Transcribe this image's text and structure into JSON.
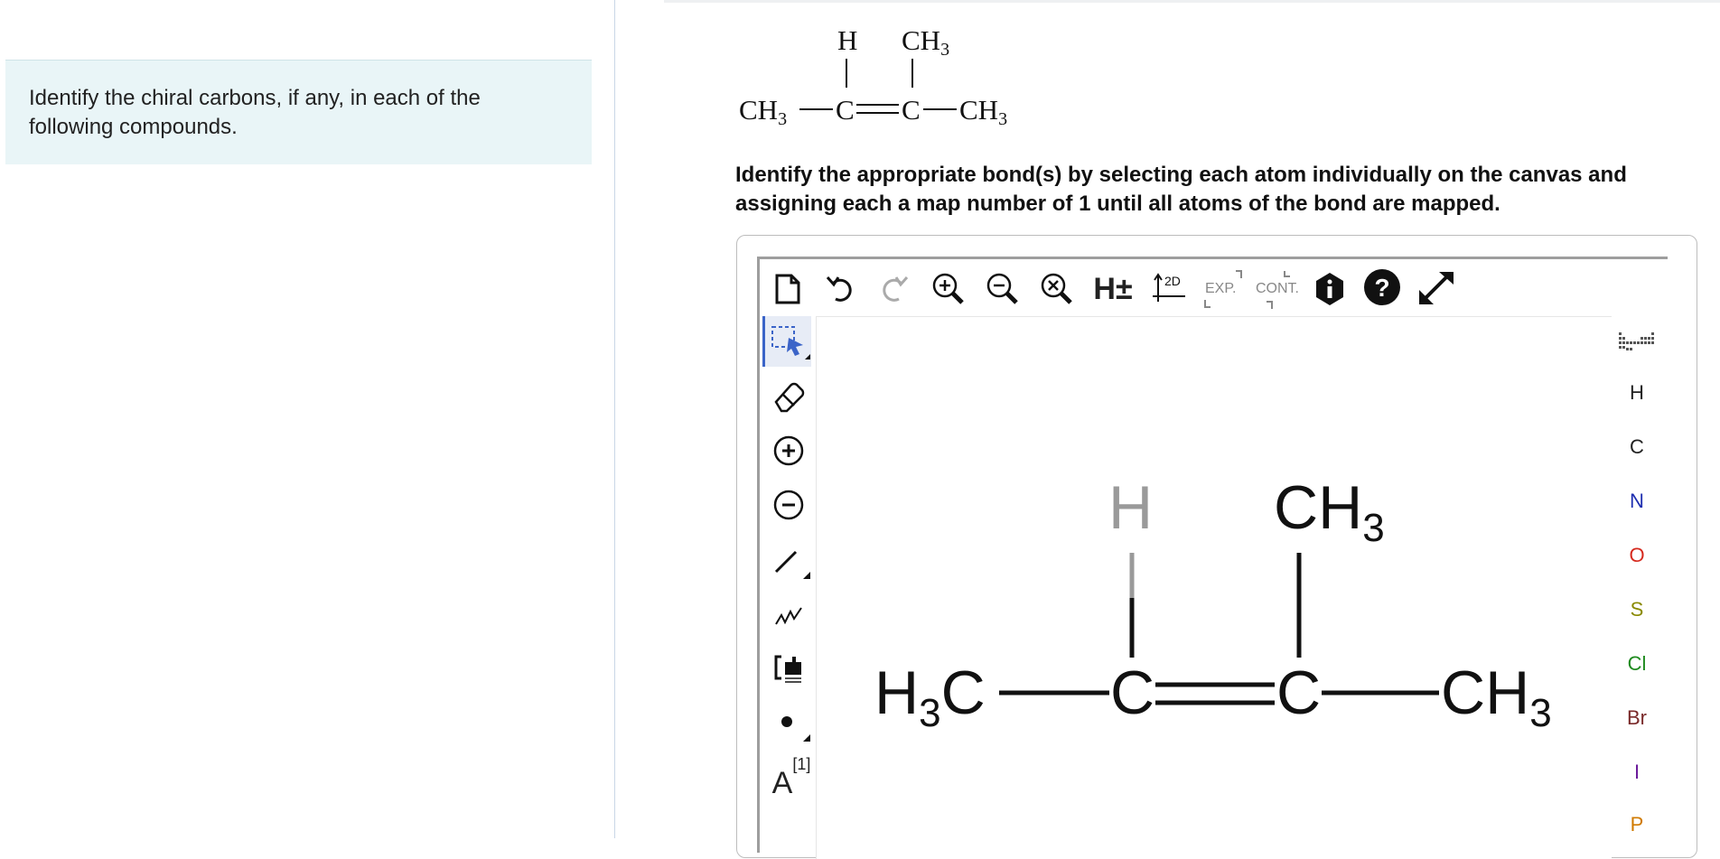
{
  "question": {
    "text": "Identify the chiral carbons, if any, in each of the following compounds."
  },
  "structure_image": {
    "top_h": "H",
    "top_ch": "CH",
    "top_sub": "3",
    "left_ch": "CH",
    "left_sub": "3",
    "c1": "C",
    "c2": "C",
    "right_ch": "CH",
    "right_sub": "3"
  },
  "instruction": "Identify the appropriate bond(s) by selecting each atom individually on the canvas and assigning each a map number of 1 until all atoms of the bond are mapped.",
  "toolbar": {
    "exp_label": "EXP.",
    "cont_label": "CONT.",
    "h_label": "H±",
    "twod_label": "2D"
  },
  "left_tools": {
    "atom_map_label": "A",
    "atom_map_sup": "[1]"
  },
  "elements": [
    {
      "symbol": "H",
      "color": "#333333"
    },
    {
      "symbol": "C",
      "color": "#111111"
    },
    {
      "symbol": "N",
      "color": "#1f2fb0"
    },
    {
      "symbol": "O",
      "color": "#d62a1e"
    },
    {
      "symbol": "S",
      "color": "#8a8a00"
    },
    {
      "symbol": "Cl",
      "color": "#1e8a1e"
    },
    {
      "symbol": "Br",
      "color": "#7a2a2a"
    },
    {
      "symbol": "I",
      "color": "#6a1a9a"
    },
    {
      "symbol": "P",
      "color": "#d07a00"
    }
  ],
  "molecule": {
    "top_h": "H",
    "top_ch": "CH",
    "top_sub": "3",
    "left_h": "H",
    "left_sub": "3",
    "left_c": "C",
    "c1": "C",
    "c2": "C",
    "right_ch": "CH",
    "right_sub": "3"
  },
  "accent_color": "#3b64c8"
}
